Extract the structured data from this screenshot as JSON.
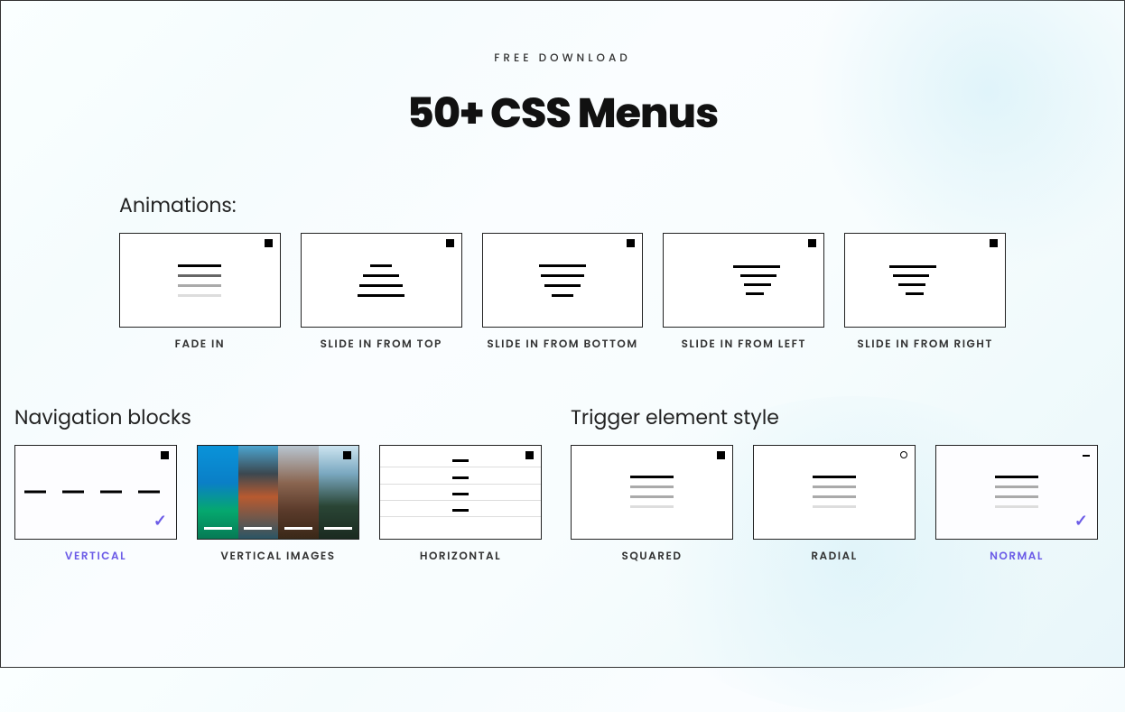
{
  "header": {
    "subtitle": "FREE DOWNLOAD",
    "title": "50+ CSS Menus"
  },
  "animations": {
    "label": "Animations:",
    "items": [
      {
        "label": "FADE IN"
      },
      {
        "label": "SLIDE IN FROM TOP"
      },
      {
        "label": "SLIDE IN FROM BOTTOM"
      },
      {
        "label": "SLIDE IN FROM LEFT"
      },
      {
        "label": "SLIDE IN FROM RIGHT"
      }
    ]
  },
  "nav_blocks": {
    "label": "Navigation blocks",
    "items": [
      {
        "label": "VERTICAL",
        "selected": true
      },
      {
        "label": "VERTICAL IMAGES",
        "selected": false
      },
      {
        "label": "HORIZONTAL",
        "selected": false
      }
    ]
  },
  "trigger": {
    "label": "Trigger element style",
    "items": [
      {
        "label": "SQUARED",
        "selected": false
      },
      {
        "label": "RADIAL",
        "selected": false
      },
      {
        "label": "NORMAL",
        "selected": true
      }
    ]
  }
}
